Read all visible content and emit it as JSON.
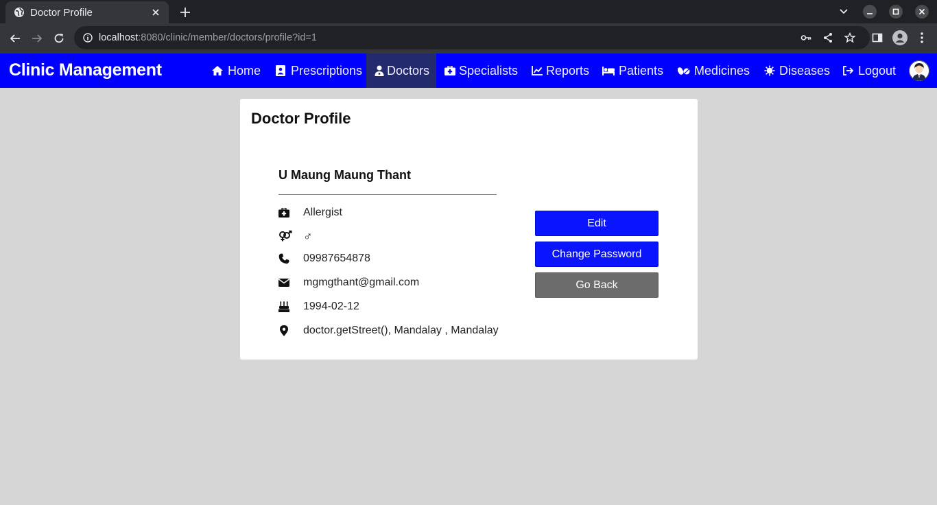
{
  "browser": {
    "tab_title": "Doctor Profile",
    "url_host": "localhost",
    "url_path": ":8080/clinic/member/doctors/profile?id=1"
  },
  "navbar": {
    "brand": "Clinic Management",
    "items": [
      {
        "label": "Home",
        "icon": "home-icon"
      },
      {
        "label": "Prescriptions",
        "icon": "prescription-icon"
      },
      {
        "label": "Doctors",
        "icon": "doctor-icon",
        "active": true
      },
      {
        "label": "Specialists",
        "icon": "medkit-icon"
      },
      {
        "label": "Reports",
        "icon": "chart-line-icon"
      },
      {
        "label": "Patients",
        "icon": "bed-icon"
      },
      {
        "label": "Medicines",
        "icon": "pills-icon"
      },
      {
        "label": "Diseases",
        "icon": "virus-icon"
      },
      {
        "label": "Logout",
        "icon": "logout-icon"
      }
    ],
    "color": "#0000ff",
    "active_color": "#232a6e"
  },
  "profile": {
    "title": "Doctor Profile",
    "name": "U Maung Maung Thant",
    "specialty": "Allergist",
    "gender_symbol": "♂",
    "phone": "09987654878",
    "email": "mgmgthant@gmail.com",
    "birthday": "1994-02-12",
    "address": "doctor.getStreet(), Mandalay , Mandalay"
  },
  "actions": {
    "edit": "Edit",
    "change_password": "Change Password",
    "go_back": "Go Back"
  }
}
